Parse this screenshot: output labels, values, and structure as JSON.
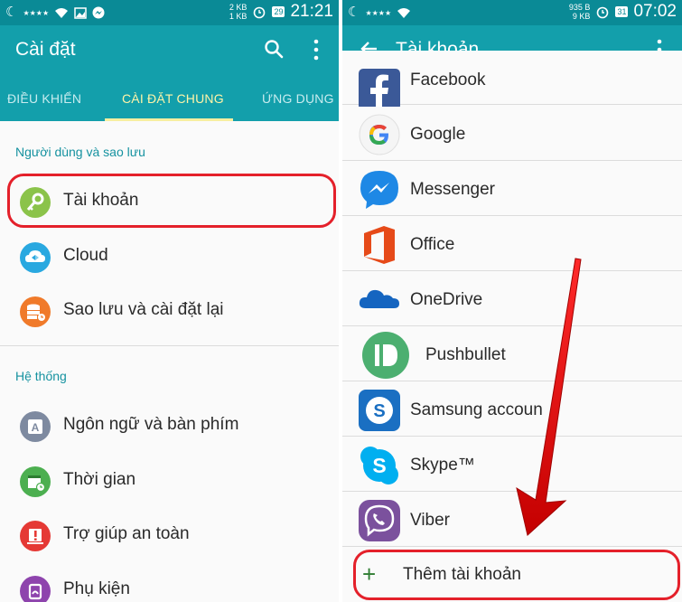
{
  "left": {
    "status": {
      "speed_up": "2 KB",
      "speed_down": "1 KB",
      "date_badge": "29",
      "time": "21:21"
    },
    "appbar": {
      "title": "Cài đặt"
    },
    "tabs": [
      {
        "label": "ĐIỀU KHIỂN"
      },
      {
        "label": "CÀI ĐẶT CHUNG"
      },
      {
        "label": "ỨNG DỤNG"
      }
    ],
    "sections": {
      "users": {
        "header": "Người dùng và sao lưu"
      },
      "system": {
        "header": "Hệ thống"
      }
    },
    "items": [
      {
        "label": "Tài khoản",
        "icon": "key-icon",
        "color": "#8bc34a"
      },
      {
        "label": "Cloud",
        "icon": "cloud-icon",
        "color": "#29a8e0"
      },
      {
        "label": "Sao lưu và cài đặt lại",
        "icon": "backup-icon",
        "color": "#f07a2a"
      },
      {
        "label": "Ngôn ngữ và bàn phím",
        "icon": "language-icon",
        "color": "#7e8aa0"
      },
      {
        "label": "Thời gian",
        "icon": "calendar-icon",
        "color": "#4caf50"
      },
      {
        "label": "Trợ giúp an toàn",
        "icon": "alert-icon",
        "color": "#e53935"
      },
      {
        "label": "Phụ kiện",
        "icon": "accessory-icon",
        "color": "#8e44ad"
      }
    ]
  },
  "right": {
    "status": {
      "speed_up": "935 B",
      "speed_down": "9 KB",
      "date_badge": "31",
      "time": "07:02"
    },
    "appbar": {
      "title": "Tài khoản"
    },
    "accounts": [
      {
        "label": "Facebook",
        "icon": "facebook-icon",
        "color": "#3b5998"
      },
      {
        "label": "Google",
        "icon": "google-icon",
        "color": "#4285f4"
      },
      {
        "label": "Messenger",
        "icon": "messenger-icon",
        "color": "#1e88e5"
      },
      {
        "label": "Office",
        "icon": "office-icon",
        "color": "#e64a19"
      },
      {
        "label": "OneDrive",
        "icon": "onedrive-icon",
        "color": "#1565c0"
      },
      {
        "label": "Pushbullet",
        "icon": "pushbullet-icon",
        "color": "#4caf70"
      },
      {
        "label": "Samsung accoun",
        "icon": "samsung-account-icon",
        "color": "#1a6fc2"
      },
      {
        "label": "Skype™",
        "icon": "skype-icon",
        "color": "#00aff0"
      },
      {
        "label": "Viber",
        "icon": "viber-icon",
        "color": "#7b519d"
      }
    ],
    "add_account": {
      "label": "Thêm tài khoản",
      "icon": "plus-icon"
    }
  },
  "accent": {
    "statusbar": "#0a8a96",
    "appbar": "#139fab",
    "highlight": "#e4202a"
  }
}
